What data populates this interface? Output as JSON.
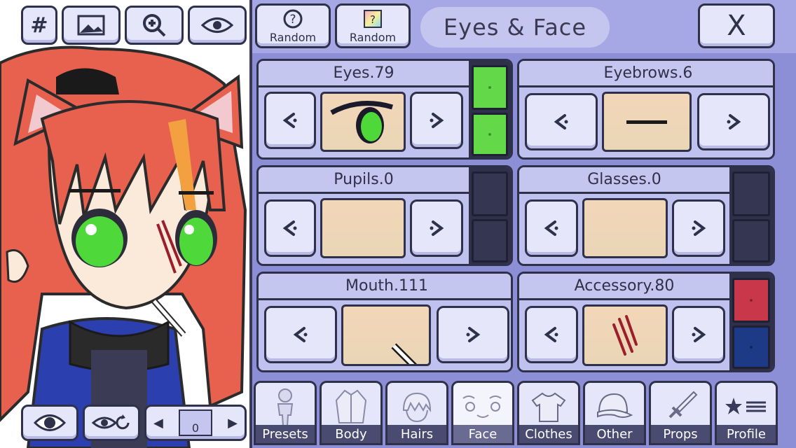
{
  "toolbar": {
    "grid_label": "#",
    "icons": [
      "grid-icon",
      "image-icon",
      "zoom-in-icon",
      "eye-icon"
    ]
  },
  "header": {
    "random1_label": "Random",
    "random2_label": "Random",
    "random1_icon": "question-icon",
    "title": "Eyes & Face",
    "close_label": "X"
  },
  "slots": {
    "eyes": {
      "label": "Eyes.79",
      "swatches": [
        "#63d94a",
        "#63d94a"
      ]
    },
    "eyebrows": {
      "label": "Eyebrows.6"
    },
    "pupils": {
      "label": "Pupils.0",
      "swatches": [
        "#2f3049",
        "#2f3049"
      ]
    },
    "glasses": {
      "label": "Glasses.0",
      "swatches": [
        "#2f3049",
        "#2f3049"
      ]
    },
    "mouth": {
      "label": "Mouth.111"
    },
    "accessory": {
      "label": "Accessory.80",
      "swatches": [
        "#c9384a",
        "#1d3a86"
      ]
    }
  },
  "tabs": [
    {
      "label": "Presets",
      "icon": "person-icon"
    },
    {
      "label": "Body",
      "icon": "jacket-icon"
    },
    {
      "label": "Hairs",
      "icon": "hair-icon"
    },
    {
      "label": "Face",
      "icon": "face-icon",
      "active": true
    },
    {
      "label": "Clothes",
      "icon": "shirt-icon"
    },
    {
      "label": "Other",
      "icon": "cap-icon"
    },
    {
      "label": "Props",
      "icon": "sword-icon"
    },
    {
      "label": "Profile",
      "icon": "star-list-icon"
    }
  ],
  "bottom_controls": {
    "pose_value": "0"
  },
  "colors": {
    "panel": "#8d8fd6",
    "header": "#a6a8e6",
    "button": "#e6e6fb",
    "outline": "#2f3049",
    "hair": "#e8604e",
    "eye": "#4fd83a"
  }
}
